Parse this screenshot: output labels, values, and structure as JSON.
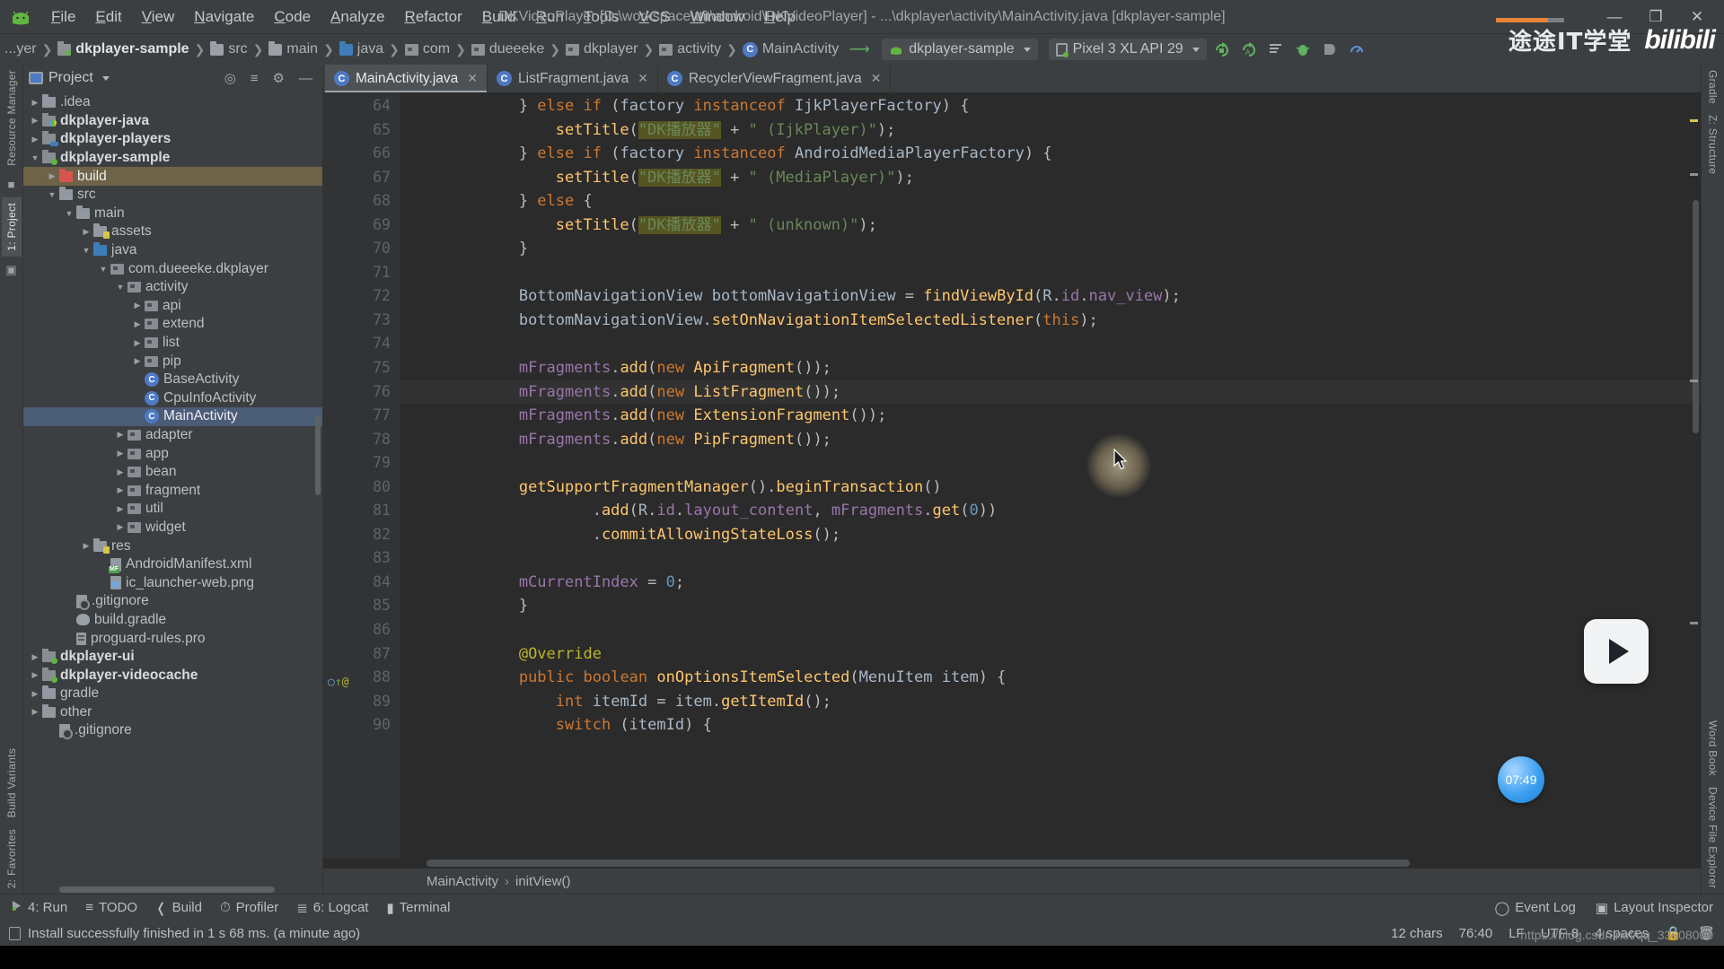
{
  "window": {
    "title": "DKVideoPlayer [D:\\workspace\\ttit\\android\\DKVideoPlayer] - ...\\dkplayer\\activity\\MainActivity.java [dkplayer-sample]",
    "minimize": "—",
    "maximize": "❐",
    "close": "✕"
  },
  "menu": {
    "items": [
      "File",
      "Edit",
      "View",
      "Navigate",
      "Code",
      "Analyze",
      "Refactor",
      "Build",
      "Run",
      "Tools",
      "VCS",
      "Window",
      "Help"
    ]
  },
  "navbar": {
    "breadcrumbs": [
      {
        "label": "...yer",
        "icon": "truncated",
        "bold": false
      },
      {
        "label": "dkplayer-sample",
        "icon": "module",
        "bold": true
      },
      {
        "label": "src",
        "icon": "folder",
        "bold": false
      },
      {
        "label": "main",
        "icon": "folder",
        "bold": false
      },
      {
        "label": "java",
        "icon": "folder-blue",
        "bold": false
      },
      {
        "label": "com",
        "icon": "package",
        "bold": false
      },
      {
        "label": "dueeeke",
        "icon": "package",
        "bold": false
      },
      {
        "label": "dkplayer",
        "icon": "package",
        "bold": false
      },
      {
        "label": "activity",
        "icon": "package",
        "bold": false
      },
      {
        "label": "MainActivity",
        "icon": "class",
        "bold": false
      }
    ],
    "run_config": "dkplayer-sample",
    "device": "Pixel 3 XL API 29",
    "toolbar_icons": [
      "run-icon",
      "debug-run-icon",
      "apply-changes-icon",
      "debug-icon",
      "stop-icon",
      "profiler-icon"
    ],
    "brand_cn": "途途IT学堂",
    "brand_bili": "bilibili"
  },
  "project_panel": {
    "title": "Project",
    "header_icons": [
      "locate-icon",
      "collapse-all-icon",
      "settings-icon",
      "hide-icon"
    ],
    "tree": [
      {
        "label": ".idea",
        "depth": 1,
        "arrow": "collapsed",
        "icon": "folder",
        "bold": false,
        "selected": ""
      },
      {
        "label": "dkplayer-java",
        "depth": 1,
        "arrow": "collapsed",
        "icon": "module-java",
        "bold": true,
        "selected": ""
      },
      {
        "label": "dkplayer-players",
        "depth": 1,
        "arrow": "collapsed",
        "icon": "module-players",
        "bold": true,
        "selected": ""
      },
      {
        "label": "dkplayer-sample",
        "depth": 1,
        "arrow": "expanded",
        "icon": "module",
        "bold": true,
        "selected": ""
      },
      {
        "label": "build",
        "depth": 2,
        "arrow": "collapsed",
        "icon": "folder-red",
        "bold": false,
        "selected": "brown"
      },
      {
        "label": "src",
        "depth": 2,
        "arrow": "expanded",
        "icon": "folder",
        "bold": false,
        "selected": ""
      },
      {
        "label": "main",
        "depth": 3,
        "arrow": "expanded",
        "icon": "folder",
        "bold": false,
        "selected": ""
      },
      {
        "label": "assets",
        "depth": 4,
        "arrow": "collapsed",
        "icon": "folder-res",
        "bold": false,
        "selected": ""
      },
      {
        "label": "java",
        "depth": 4,
        "arrow": "expanded",
        "icon": "folder-blue",
        "bold": false,
        "selected": ""
      },
      {
        "label": "com.dueeeke.dkplayer",
        "depth": 5,
        "arrow": "expanded",
        "icon": "package",
        "bold": false,
        "selected": ""
      },
      {
        "label": "activity",
        "depth": 6,
        "arrow": "expanded",
        "icon": "package",
        "bold": false,
        "selected": ""
      },
      {
        "label": "api",
        "depth": 7,
        "arrow": "collapsed",
        "icon": "package",
        "bold": false,
        "selected": ""
      },
      {
        "label": "extend",
        "depth": 7,
        "arrow": "collapsed",
        "icon": "package",
        "bold": false,
        "selected": ""
      },
      {
        "label": "list",
        "depth": 7,
        "arrow": "collapsed",
        "icon": "package",
        "bold": false,
        "selected": ""
      },
      {
        "label": "pip",
        "depth": 7,
        "arrow": "collapsed",
        "icon": "package",
        "bold": false,
        "selected": ""
      },
      {
        "label": "BaseActivity",
        "depth": 7,
        "arrow": "none",
        "icon": "class",
        "bold": false,
        "selected": ""
      },
      {
        "label": "CpuInfoActivity",
        "depth": 7,
        "arrow": "none",
        "icon": "class",
        "bold": false,
        "selected": ""
      },
      {
        "label": "MainActivity",
        "depth": 7,
        "arrow": "none",
        "icon": "class",
        "bold": false,
        "selected": "blue"
      },
      {
        "label": "adapter",
        "depth": 6,
        "arrow": "collapsed",
        "icon": "package",
        "bold": false,
        "selected": ""
      },
      {
        "label": "app",
        "depth": 6,
        "arrow": "collapsed",
        "icon": "package",
        "bold": false,
        "selected": ""
      },
      {
        "label": "bean",
        "depth": 6,
        "arrow": "collapsed",
        "icon": "package",
        "bold": false,
        "selected": ""
      },
      {
        "label": "fragment",
        "depth": 6,
        "arrow": "collapsed",
        "icon": "package",
        "bold": false,
        "selected": ""
      },
      {
        "label": "util",
        "depth": 6,
        "arrow": "collapsed",
        "icon": "package",
        "bold": false,
        "selected": ""
      },
      {
        "label": "widget",
        "depth": 6,
        "arrow": "collapsed",
        "icon": "package",
        "bold": false,
        "selected": ""
      },
      {
        "label": "res",
        "depth": 4,
        "arrow": "collapsed",
        "icon": "folder-res",
        "bold": false,
        "selected": ""
      },
      {
        "label": "AndroidManifest.xml",
        "depth": 5,
        "arrow": "none",
        "icon": "manifest",
        "bold": false,
        "selected": ""
      },
      {
        "label": "ic_launcher-web.png",
        "depth": 5,
        "arrow": "none",
        "icon": "png",
        "bold": false,
        "selected": ""
      },
      {
        "label": ".gitignore",
        "depth": 3,
        "arrow": "none",
        "icon": "gitignore",
        "bold": false,
        "selected": ""
      },
      {
        "label": "build.gradle",
        "depth": 3,
        "arrow": "none",
        "icon": "gradle",
        "bold": false,
        "selected": ""
      },
      {
        "label": "proguard-rules.pro",
        "depth": 3,
        "arrow": "none",
        "icon": "pro",
        "bold": false,
        "selected": ""
      },
      {
        "label": "dkplayer-ui",
        "depth": 1,
        "arrow": "collapsed",
        "icon": "module",
        "bold": true,
        "selected": ""
      },
      {
        "label": "dkplayer-videocache",
        "depth": 1,
        "arrow": "collapsed",
        "icon": "module",
        "bold": true,
        "selected": ""
      },
      {
        "label": "gradle",
        "depth": 1,
        "arrow": "collapsed",
        "icon": "folder",
        "bold": false,
        "selected": ""
      },
      {
        "label": "other",
        "depth": 1,
        "arrow": "collapsed",
        "icon": "folder",
        "bold": false,
        "selected": ""
      },
      {
        "label": ".gitignore",
        "depth": 2,
        "arrow": "none",
        "icon": "gitignore",
        "bold": false,
        "selected": ""
      }
    ]
  },
  "left_rail": {
    "tabs": [
      "1: Project",
      "Resource Manager"
    ],
    "bottom_tabs": [
      "2: Favorites",
      "Build Variants"
    ]
  },
  "right_rail": {
    "tabs": [
      "Gradle",
      "Z: Structure",
      "Word Book",
      "Device File Explorer"
    ]
  },
  "editor": {
    "tabs": [
      {
        "label": "MainActivity.java",
        "active": true,
        "close": "✕"
      },
      {
        "label": "ListFragment.java",
        "active": false,
        "close": "✕"
      },
      {
        "label": "RecyclerViewFragment.java",
        "active": false,
        "close": "✕"
      }
    ],
    "first_line_number": 64,
    "lines": [
      {
        "num": 64,
        "text": "} else if (factory instanceof IjkPlayerFactory) {",
        "current": false,
        "partial": true
      },
      {
        "num": 65,
        "text": "    setTitle(\"DK播放器\" + \" (IjkPlayer)\");",
        "current": false
      },
      {
        "num": 66,
        "text": "} else if (factory instanceof AndroidMediaPlayerFactory) {",
        "current": false
      },
      {
        "num": 67,
        "text": "    setTitle(\"DK播放器\" + \" (MediaPlayer)\");",
        "current": false
      },
      {
        "num": 68,
        "text": "} else {",
        "current": false
      },
      {
        "num": 69,
        "text": "    setTitle(\"DK播放器\" + \" (unknown)\");",
        "current": false
      },
      {
        "num": 70,
        "text": "}",
        "current": false
      },
      {
        "num": 71,
        "text": "",
        "current": false
      },
      {
        "num": 72,
        "text": "BottomNavigationView bottomNavigationView = findViewById(R.id.nav_view);",
        "current": false
      },
      {
        "num": 73,
        "text": "bottomNavigationView.setOnNavigationItemSelectedListener(this);",
        "current": false
      },
      {
        "num": 74,
        "text": "",
        "current": false
      },
      {
        "num": 75,
        "text": "mFragments.add(new ApiFragment());",
        "current": false
      },
      {
        "num": 76,
        "text": "mFragments.add(new ListFragment());",
        "current": true
      },
      {
        "num": 77,
        "text": "mFragments.add(new ExtensionFragment());",
        "current": false
      },
      {
        "num": 78,
        "text": "mFragments.add(new PipFragment());",
        "current": false
      },
      {
        "num": 79,
        "text": "",
        "current": false
      },
      {
        "num": 80,
        "text": "getSupportFragmentManager().beginTransaction()",
        "current": false
      },
      {
        "num": 81,
        "text": "        .add(R.id.layout_content, mFragments.get(0))",
        "current": false
      },
      {
        "num": 82,
        "text": "        .commitAllowingStateLoss();",
        "current": false
      },
      {
        "num": 83,
        "text": "",
        "current": false
      },
      {
        "num": 84,
        "text": "mCurrentIndex = 0;",
        "current": false
      },
      {
        "num": 85,
        "text": "}",
        "current": false
      },
      {
        "num": 86,
        "text": "",
        "current": false
      },
      {
        "num": 87,
        "text": "@Override",
        "current": false
      },
      {
        "num": 88,
        "text": "public boolean onOptionsItemSelected(MenuItem item) {",
        "current": false
      },
      {
        "num": 89,
        "text": "    int itemId = item.getItemId();",
        "current": false
      },
      {
        "num": 90,
        "text": "    switch (itemId) {",
        "current": false
      }
    ],
    "status_breadcrumb": [
      "MainActivity",
      "initView()"
    ]
  },
  "toolwindows": {
    "left": [
      {
        "label": "4: Run",
        "underline": "4",
        "icon": "run-icon"
      },
      {
        "label": "TODO",
        "underline": "",
        "icon": "todo-icon"
      },
      {
        "label": "Build",
        "underline": "B",
        "icon": "build-icon"
      },
      {
        "label": "Profiler",
        "underline": "",
        "icon": "profiler-icon"
      },
      {
        "label": "6: Logcat",
        "underline": "6",
        "icon": "logcat-icon"
      },
      {
        "label": "Terminal",
        "underline": "T",
        "icon": "terminal-icon"
      }
    ],
    "right": [
      {
        "label": "Event Log",
        "icon": "event-log-icon"
      },
      {
        "label": "Layout Inspector",
        "icon": "layout-inspector-icon"
      }
    ]
  },
  "statusbar": {
    "message": "Install successfully finished in 1 s 68 ms. (a minute ago)",
    "chars": "12 chars",
    "caret": "76:40",
    "line_sep": "LF",
    "encoding": "UTF-8",
    "indent": "4 spaces",
    "lock_icon": "lock-icon",
    "trash_icon": "trash-icon"
  },
  "overlay": {
    "clock": "07:49",
    "watermark": "https://blog.csdn.net/qq_33608000"
  },
  "colors": {
    "bg": "#3c3f41",
    "editor_bg": "#2b2b2b",
    "accent": "#4b6eaf",
    "keyword": "#cc7832",
    "string": "#6a8759",
    "number": "#6897bb",
    "method": "#ffc66d",
    "field": "#9876aa",
    "annotation": "#bbb529",
    "selection": "#4b5c77",
    "orange": "#e8833a",
    "green": "#62b543"
  }
}
